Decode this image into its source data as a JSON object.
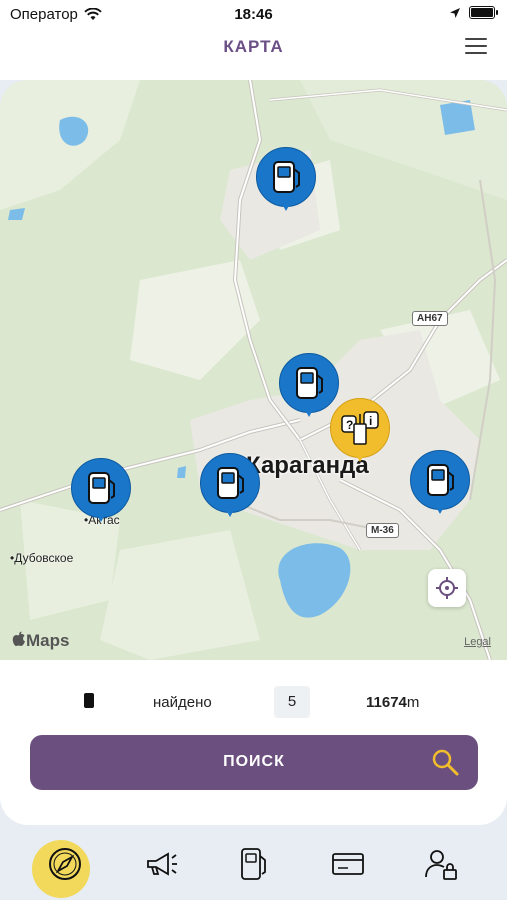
{
  "status_bar": {
    "carrier": "Оператор",
    "time": "18:46"
  },
  "header": {
    "title": "КАРТА"
  },
  "map": {
    "city": "Караганда",
    "towns": [
      "Актас",
      "Дубовское"
    ],
    "road_badges": [
      "AH67",
      "M-36"
    ],
    "maps_logo": "Maps",
    "legal": "Legal",
    "pin_color": "#1976c9",
    "selected_pin_color": "#f2bd2c"
  },
  "info": {
    "found_label": "найдено",
    "count": "5",
    "distance_value": "11674",
    "distance_unit": "m"
  },
  "search": {
    "label": "ПОИСК",
    "color": "#6b4f7e"
  },
  "tabbar": {
    "items": [
      "compass-icon",
      "megaphone-icon",
      "fuel-pump-icon",
      "card-icon",
      "user-lock-icon"
    ],
    "active_color": "#f2d95c"
  }
}
